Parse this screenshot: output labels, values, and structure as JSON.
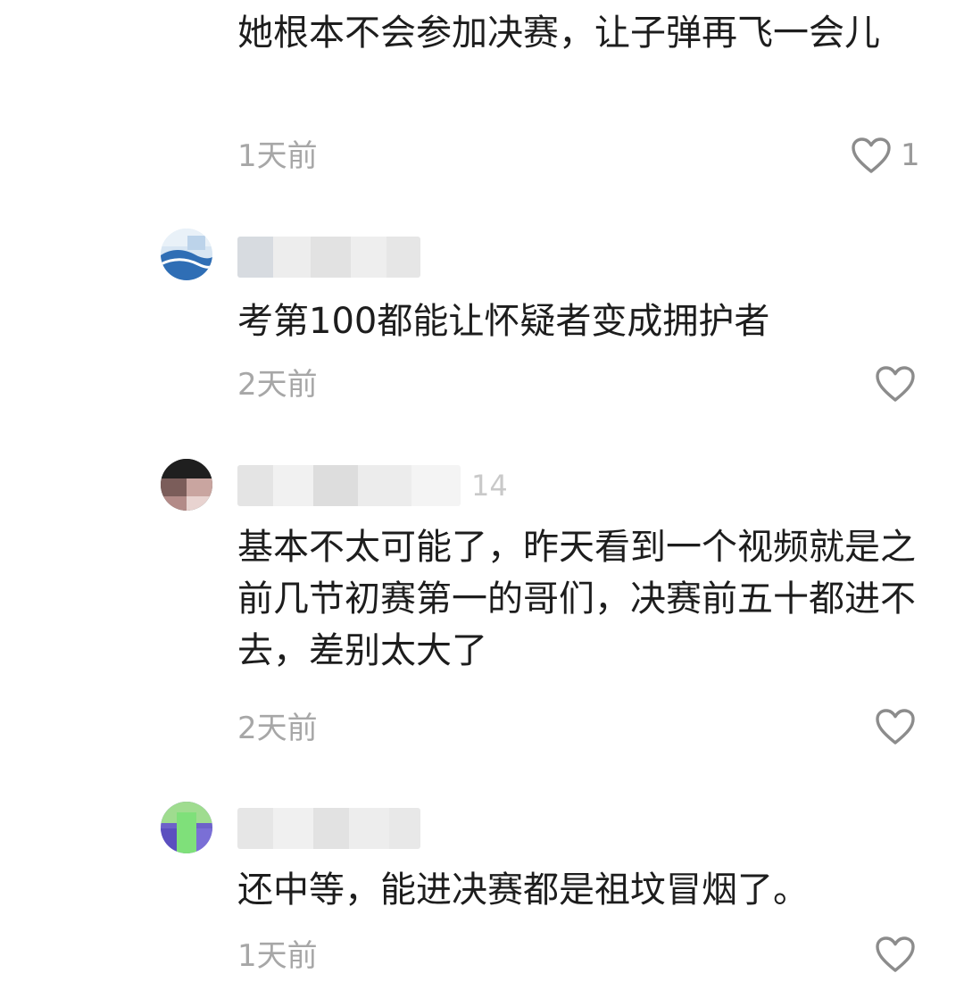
{
  "comments": [
    {
      "text": "她根本不会参加决赛，让子弹再飞一会儿",
      "time": "1天前",
      "likes": "1",
      "like_icon": "heart-outline-icon"
    },
    {
      "username_visible": "",
      "text": "考第100都能让怀疑者变成拥护者",
      "time": "2天前",
      "likes": "",
      "like_icon": "heart-outline-icon"
    },
    {
      "username_visible": "14",
      "text": "基本不太可能了，昨天看到一个视频就是之前几节初赛第一的哥们，决赛前五十都进不去，差别太大了",
      "time": "2天前",
      "likes": "",
      "like_icon": "heart-outline-icon"
    },
    {
      "username_visible": "",
      "text": "还中等，能进决赛都是祖坟冒烟了。",
      "time": "1天前",
      "likes": "",
      "like_icon": "heart-outline-icon"
    }
  ],
  "colors": {
    "text": "#1d1d1d",
    "meta": "#a7a7a7",
    "icon": "#8c8c8c"
  }
}
